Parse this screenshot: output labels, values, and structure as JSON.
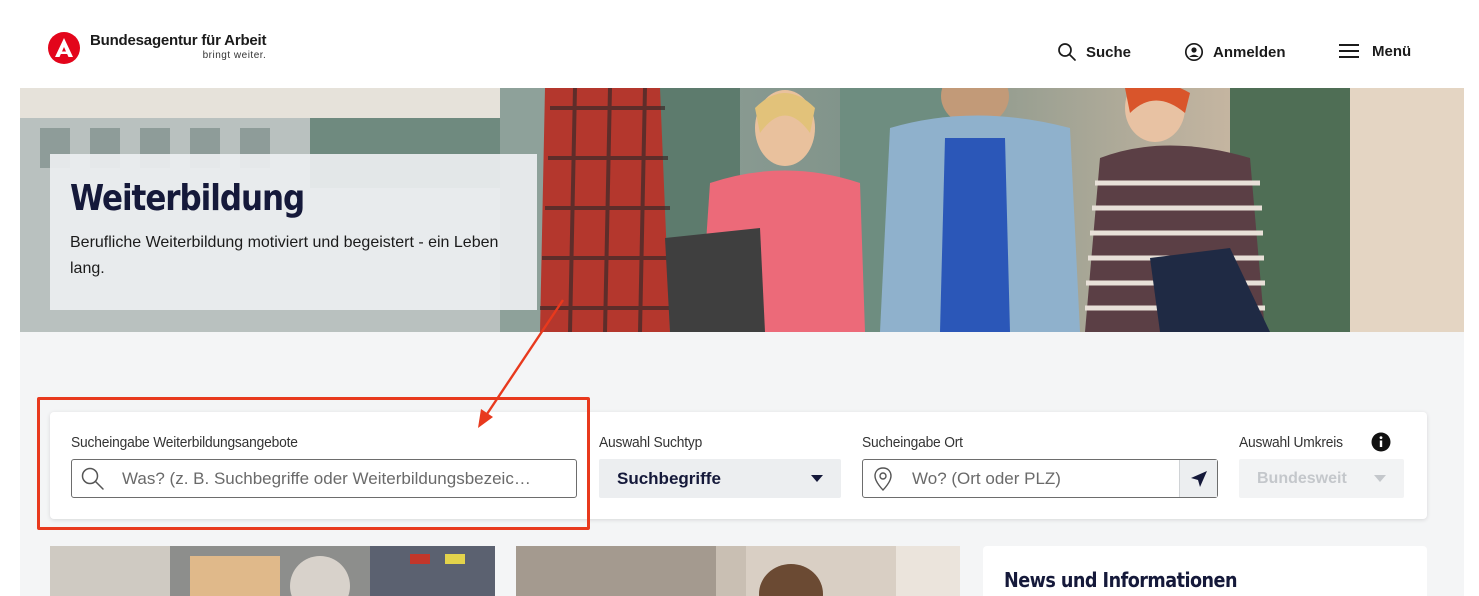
{
  "header": {
    "logo_title": "Bundesagentur für Arbeit",
    "logo_tagline": "bringt weiter.",
    "nav": {
      "search_label": "Suche",
      "login_label": "Anmelden",
      "menu_label": "Menü"
    }
  },
  "hero": {
    "title": "Weiterbildung",
    "text": "Berufliche Weiterbildung motiviert und begeistert - ein Leben lang."
  },
  "search": {
    "keyword_label": "Sucheingabe Weiterbildungsangebote",
    "keyword_placeholder": "Was? (z. B. Suchbegriffe oder Weiterbildungsbezeic…",
    "type_label": "Auswahl Suchtyp",
    "type_value": "Suchbegriffe",
    "location_label": "Sucheingabe Ort",
    "location_placeholder": "Wo? (Ort oder PLZ)",
    "radius_label": "Auswahl Umkreis",
    "radius_value": "Bundesweit"
  },
  "news": {
    "title": "News und Informationen"
  },
  "colors": {
    "brand_red": "#e3051b",
    "navy": "#15193a",
    "annotation": "#e8391d"
  },
  "icons": [
    "logo-mark-icon",
    "search-icon",
    "user-icon",
    "menu-icon",
    "magnifier-icon",
    "chevron-down-icon",
    "location-pin-icon",
    "locate-arrow-icon",
    "info-icon"
  ]
}
